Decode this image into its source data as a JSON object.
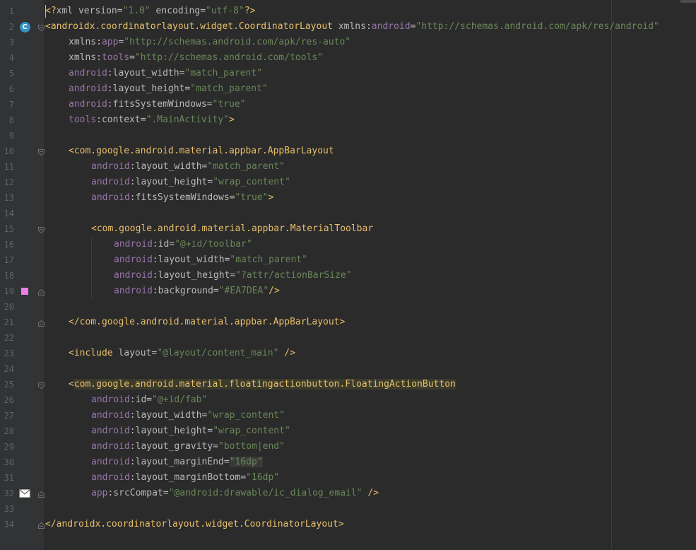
{
  "editor": {
    "lines": [
      {
        "n": "1",
        "tokens": [
          {
            "t": "<?",
            "c": "tag"
          },
          {
            "t": "xml ",
            "c": "attr"
          },
          {
            "t": "version",
            "c": "attr"
          },
          {
            "t": "=",
            "c": "attr"
          },
          {
            "t": "\"1.0\"",
            "c": "val"
          },
          {
            "t": " encoding",
            "c": "attr"
          },
          {
            "t": "=",
            "c": "attr"
          },
          {
            "t": "\"utf-8\"",
            "c": "val"
          },
          {
            "t": "?>",
            "c": "tag"
          }
        ]
      },
      {
        "n": "2",
        "tokens": [
          {
            "t": "<androidx.coordinatorlayout.widget.CoordinatorLayout",
            "c": "tag"
          },
          {
            "t": " xmlns:",
            "c": "attr"
          },
          {
            "t": "android",
            "c": "ns"
          },
          {
            "t": "=",
            "c": "attr"
          },
          {
            "t": "\"http://schemas.android.com/apk/res/android\"",
            "c": "val"
          }
        ]
      },
      {
        "n": "3",
        "tokens": [
          {
            "t": "xmlns:",
            "c": "attr"
          },
          {
            "t": "app",
            "c": "ns"
          },
          {
            "t": "=",
            "c": "attr"
          },
          {
            "t": "\"http://schemas.android.com/apk/res-auto\"",
            "c": "val"
          }
        ]
      },
      {
        "n": "4",
        "tokens": [
          {
            "t": "xmlns:",
            "c": "attr"
          },
          {
            "t": "tools",
            "c": "ns"
          },
          {
            "t": "=",
            "c": "attr"
          },
          {
            "t": "\"http://schemas.android.com/tools\"",
            "c": "val"
          }
        ]
      },
      {
        "n": "5",
        "tokens": [
          {
            "t": "android",
            "c": "ns"
          },
          {
            "t": ":layout_width=",
            "c": "attr"
          },
          {
            "t": "\"match_parent\"",
            "c": "val"
          }
        ]
      },
      {
        "n": "6",
        "tokens": [
          {
            "t": "android",
            "c": "ns"
          },
          {
            "t": ":layout_height=",
            "c": "attr"
          },
          {
            "t": "\"match_parent\"",
            "c": "val"
          }
        ]
      },
      {
        "n": "7",
        "tokens": [
          {
            "t": "android",
            "c": "ns"
          },
          {
            "t": ":fitsSystemWindows=",
            "c": "attr"
          },
          {
            "t": "\"true\"",
            "c": "val"
          }
        ]
      },
      {
        "n": "8",
        "tokens": [
          {
            "t": "tools",
            "c": "ns"
          },
          {
            "t": ":context=",
            "c": "attr"
          },
          {
            "t": "\".MainActivity\"",
            "c": "val"
          },
          {
            "t": ">",
            "c": "tag"
          }
        ]
      },
      {
        "n": "9",
        "tokens": []
      },
      {
        "n": "10",
        "tokens": [
          {
            "t": "<com.google.android.material.appbar.AppBarLayout",
            "c": "tag"
          }
        ]
      },
      {
        "n": "11",
        "tokens": [
          {
            "t": "android",
            "c": "ns"
          },
          {
            "t": ":layout_width=",
            "c": "attr"
          },
          {
            "t": "\"match_parent\"",
            "c": "val"
          }
        ]
      },
      {
        "n": "12",
        "tokens": [
          {
            "t": "android",
            "c": "ns"
          },
          {
            "t": ":layout_height=",
            "c": "attr"
          },
          {
            "t": "\"wrap_content\"",
            "c": "val"
          }
        ]
      },
      {
        "n": "13",
        "tokens": [
          {
            "t": "android",
            "c": "ns"
          },
          {
            "t": ":fitsSystemWindows=",
            "c": "attr"
          },
          {
            "t": "\"true\"",
            "c": "val"
          },
          {
            "t": ">",
            "c": "tag"
          }
        ]
      },
      {
        "n": "14",
        "tokens": []
      },
      {
        "n": "15",
        "tokens": [
          {
            "t": "<com.google.android.material.appbar.MaterialToolbar",
            "c": "tag"
          }
        ]
      },
      {
        "n": "16",
        "tokens": [
          {
            "t": "android",
            "c": "ns"
          },
          {
            "t": ":id=",
            "c": "attr"
          },
          {
            "t": "\"@+id/toolbar\"",
            "c": "val"
          }
        ]
      },
      {
        "n": "17",
        "tokens": [
          {
            "t": "android",
            "c": "ns"
          },
          {
            "t": ":layout_width=",
            "c": "attr"
          },
          {
            "t": "\"match_parent\"",
            "c": "val"
          }
        ]
      },
      {
        "n": "18",
        "tokens": [
          {
            "t": "android",
            "c": "ns"
          },
          {
            "t": ":layout_height=",
            "c": "attr"
          },
          {
            "t": "\"?attr/actionBarSize\"",
            "c": "val"
          }
        ]
      },
      {
        "n": "19",
        "tokens": [
          {
            "t": "android",
            "c": "ns"
          },
          {
            "t": ":background=",
            "c": "attr"
          },
          {
            "t": "\"#EA7DEA\"",
            "c": "val"
          },
          {
            "t": "/>",
            "c": "tag"
          }
        ]
      },
      {
        "n": "20",
        "tokens": []
      },
      {
        "n": "21",
        "tokens": [
          {
            "t": "</com.google.android.material.appbar.AppBarLayout>",
            "c": "tag"
          }
        ]
      },
      {
        "n": "22",
        "tokens": []
      },
      {
        "n": "23",
        "tokens": [
          {
            "t": "<include ",
            "c": "tag"
          },
          {
            "t": "layout=",
            "c": "attr"
          },
          {
            "t": "\"@layout/content_main\"",
            "c": "val"
          },
          {
            "t": " />",
            "c": "tag"
          }
        ]
      },
      {
        "n": "24",
        "tokens": []
      },
      {
        "n": "25",
        "tokens": [
          {
            "t": "<",
            "c": "tag"
          },
          {
            "t": "com.google.android.material.floatingactionbutton.FloatingActionButton",
            "c": "tag hl"
          }
        ]
      },
      {
        "n": "26",
        "tokens": [
          {
            "t": "android",
            "c": "ns"
          },
          {
            "t": ":id=",
            "c": "attr"
          },
          {
            "t": "\"@+id/fab\"",
            "c": "val"
          }
        ]
      },
      {
        "n": "27",
        "tokens": [
          {
            "t": "android",
            "c": "ns"
          },
          {
            "t": ":layout_width=",
            "c": "attr"
          },
          {
            "t": "\"wrap_content\"",
            "c": "val"
          }
        ]
      },
      {
        "n": "28",
        "tokens": [
          {
            "t": "android",
            "c": "ns"
          },
          {
            "t": ":layout_height=",
            "c": "attr"
          },
          {
            "t": "\"wrap_content\"",
            "c": "val"
          }
        ]
      },
      {
        "n": "29",
        "tokens": [
          {
            "t": "android",
            "c": "ns"
          },
          {
            "t": ":layout_gravity=",
            "c": "attr"
          },
          {
            "t": "\"bottom|end\"",
            "c": "val"
          }
        ]
      },
      {
        "n": "30",
        "tokens": [
          {
            "t": "android",
            "c": "ns"
          },
          {
            "t": ":layout_marginEnd=",
            "c": "attr"
          },
          {
            "t": "\"16dp\"",
            "c": "val hl-val"
          }
        ]
      },
      {
        "n": "31",
        "tokens": [
          {
            "t": "android",
            "c": "ns"
          },
          {
            "t": ":layout_marginBottom=",
            "c": "attr"
          },
          {
            "t": "\"16dp\"",
            "c": "val"
          }
        ]
      },
      {
        "n": "32",
        "tokens": [
          {
            "t": "app",
            "c": "ns"
          },
          {
            "t": ":srcCompat=",
            "c": "attr"
          },
          {
            "t": "\"@android:drawable/ic_dialog_email\"",
            "c": "val"
          },
          {
            "t": " />",
            "c": "tag"
          }
        ]
      },
      {
        "n": "33",
        "tokens": []
      },
      {
        "n": "34",
        "tokens": [
          {
            "t": "</androidx.coordinatorlayout.widget.CoordinatorLayout>",
            "c": "tag"
          }
        ]
      }
    ],
    "gutter_icons": {
      "2": "class-c-icon",
      "19": "color-swatch-icon",
      "32": "email-drawable-icon"
    },
    "class_badge_letter": "C",
    "swatch_color": "#EA7DEA"
  }
}
